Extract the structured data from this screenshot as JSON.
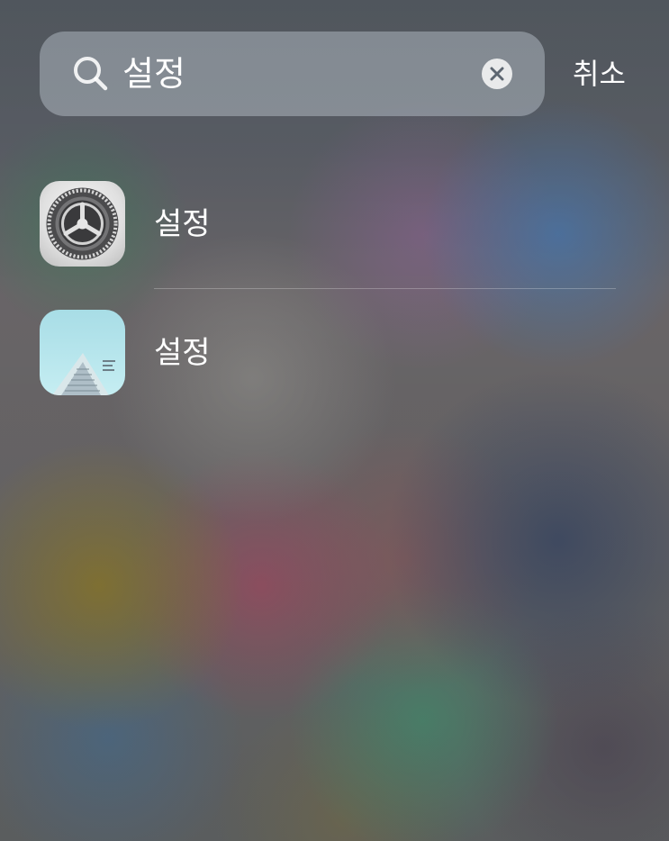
{
  "search": {
    "query": "설정",
    "clear_icon": "clear-circle-icon",
    "search_icon": "magnifying-glass-icon"
  },
  "cancel": {
    "label": "취소"
  },
  "results": [
    {
      "label": "설정",
      "icon": "settings-gear-icon"
    },
    {
      "label": "설정",
      "icon": "building-photo-icon"
    }
  ],
  "colors": {
    "text": "#ffffff",
    "search_field": "#c8d2dc",
    "settings_icon_background": "#e0e0e0",
    "photo_icon_background": "#b6e5ec"
  }
}
